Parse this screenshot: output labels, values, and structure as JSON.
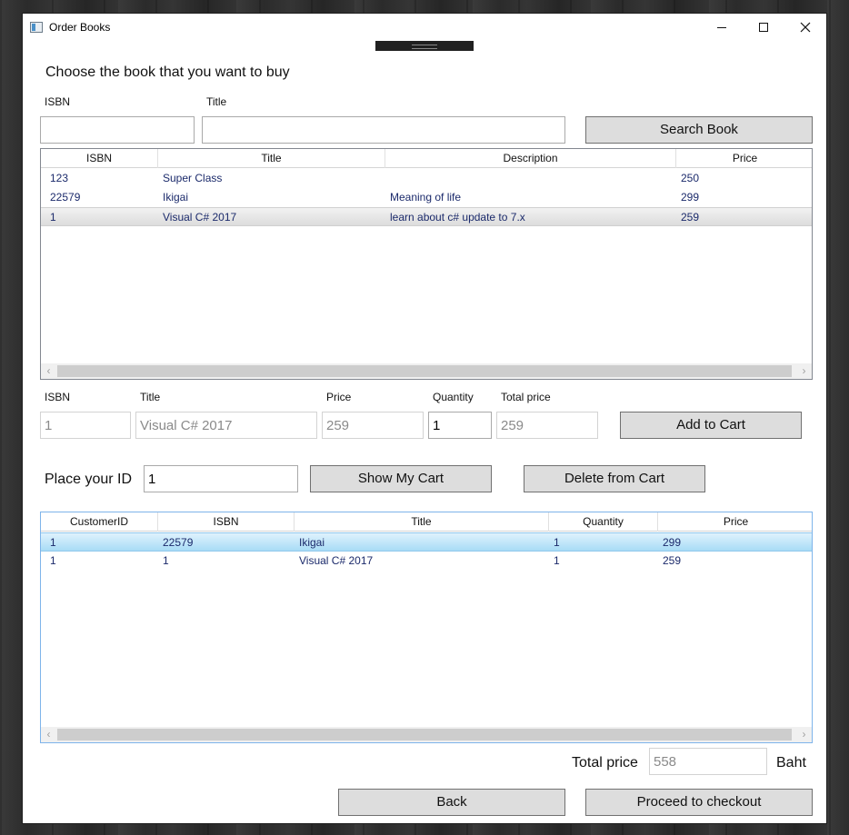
{
  "window": {
    "title": "Order Books"
  },
  "heading": "Choose the book that you want to buy",
  "search": {
    "isbn_label": "ISBN",
    "title_label": "Title",
    "isbn_value": "",
    "title_value": "",
    "button": "Search Book"
  },
  "books": {
    "columns": [
      "ISBN",
      "Title",
      "Description",
      "Price"
    ],
    "rows": [
      {
        "isbn": "123",
        "title": "Super Class",
        "description": "",
        "price": "250"
      },
      {
        "isbn": "22579",
        "title": "Ikigai",
        "description": "Meaning of life",
        "price": "299"
      },
      {
        "isbn": "1",
        "title": "Visual C# 2017",
        "description": "learn about c# update to 7.x",
        "price": "259"
      }
    ],
    "selected_row": 2
  },
  "detail": {
    "isbn_label": "ISBN",
    "title_label": "Title",
    "price_label": "Price",
    "quantity_label": "Quantity",
    "total_label": "Total price",
    "isbn_value": "1",
    "title_value": "Visual C# 2017",
    "price_value": "259",
    "quantity_value": "1",
    "total_value": "259",
    "add_button": "Add to Cart"
  },
  "customer": {
    "id_label": "Place your ID",
    "id_value": "1",
    "show_cart_button": "Show My Cart",
    "delete_button": "Delete from Cart"
  },
  "cart": {
    "columns": [
      "CustomerID",
      "ISBN",
      "Title",
      "Quantity",
      "Price"
    ],
    "rows": [
      {
        "customer_id": "1",
        "isbn": "22579",
        "title": "Ikigai",
        "quantity": "1",
        "price": "299"
      },
      {
        "customer_id": "1",
        "isbn": "1",
        "title": "Visual C# 2017",
        "quantity": "1",
        "price": "259"
      }
    ],
    "selected_row": 0
  },
  "footer": {
    "total_label": "Total price",
    "total_value": "558",
    "currency": "Baht",
    "back_button": "Back",
    "checkout_button": "Proceed to checkout"
  }
}
